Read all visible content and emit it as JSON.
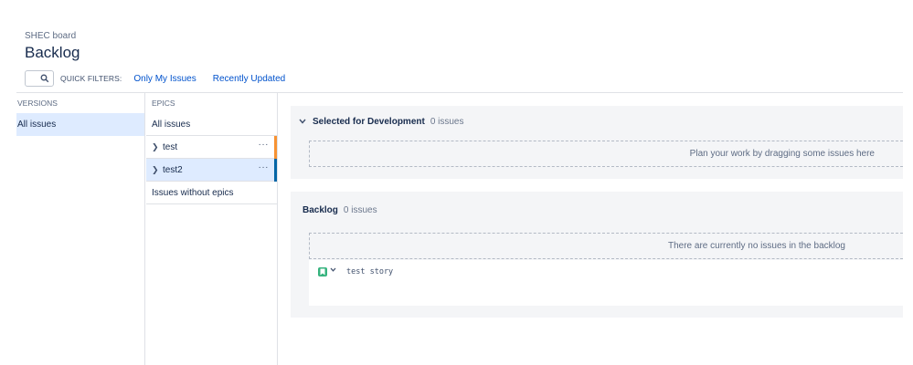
{
  "header": {
    "board_name": "SHEC board",
    "page_title": "Backlog"
  },
  "quick_filters": {
    "label": "QUICK FILTERS:",
    "items": [
      "Only My Issues",
      "Recently Updated"
    ]
  },
  "versions": {
    "heading": "VERSIONS",
    "items": [
      {
        "label": "All issues",
        "selected": true
      }
    ]
  },
  "epics": {
    "heading": "EPICS",
    "all_label": "All issues",
    "items": [
      {
        "label": "test",
        "color": "#f79232",
        "selected": false
      },
      {
        "label": "test2",
        "color": "#0065a6",
        "selected": true
      }
    ],
    "without_label": "Issues without epics"
  },
  "sprint": {
    "title": "Selected for Development",
    "count": "0 issues",
    "placeholder": "Plan your work by dragging some issues here"
  },
  "backlog": {
    "title": "Backlog",
    "count": "0 issues",
    "placeholder": "There are currently no issues in the backlog",
    "issues": [
      {
        "type_icon": "story-icon",
        "summary": "test story",
        "type_color": "#36b37e"
      }
    ]
  },
  "icons": {
    "search": "search-icon",
    "more": "more-icon",
    "chevron": "chevron-right-icon",
    "collapse": "chevron-down-icon"
  }
}
